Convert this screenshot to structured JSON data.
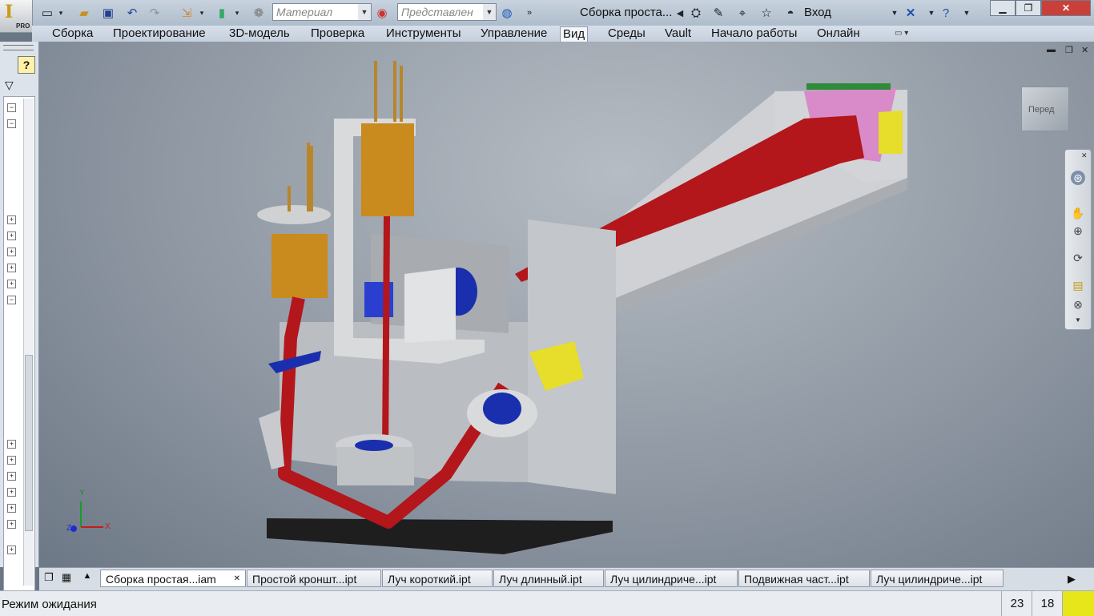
{
  "app": {
    "logo_letter": "I",
    "badge": "PRO"
  },
  "quick_access": {
    "material_placeholder": "Материал",
    "representation_placeholder": "Представлен"
  },
  "document_title": "Сборка проста...",
  "login": "Вход",
  "ribbon_tabs": [
    {
      "label": "Сборка"
    },
    {
      "label": "Проектирование"
    },
    {
      "label": "3D-модель"
    },
    {
      "label": "Проверка"
    },
    {
      "label": "Инструменты"
    },
    {
      "label": "Управление"
    },
    {
      "label": "Вид",
      "active": true
    },
    {
      "label": "Среды"
    },
    {
      "label": "Vault"
    },
    {
      "label": "Начало работы"
    },
    {
      "label": "Онлайн"
    }
  ],
  "viewcube": {
    "face_label": "Перед"
  },
  "axes": {
    "x": "X",
    "y": "Y",
    "z": "Z"
  },
  "doc_tabs": [
    {
      "label": "Сборка простая...iam",
      "active": true
    },
    {
      "label": "Простой кроншт...ipt"
    },
    {
      "label": "Луч короткий.ipt"
    },
    {
      "label": "Луч длинный.ipt"
    },
    {
      "label": "Луч цилиндриче...ipt"
    },
    {
      "label": "Подвижная част...ipt"
    },
    {
      "label": "Луч цилиндриче...ipt"
    }
  ],
  "status": {
    "text": "Режим ожидания",
    "count_a": "23",
    "count_b": "18"
  },
  "colors": {
    "beam": "#b3161b",
    "coil": "#c98a1e",
    "bracket": "#d9dadc",
    "base": "#1e1e1e",
    "lens": "#1a2fae"
  }
}
